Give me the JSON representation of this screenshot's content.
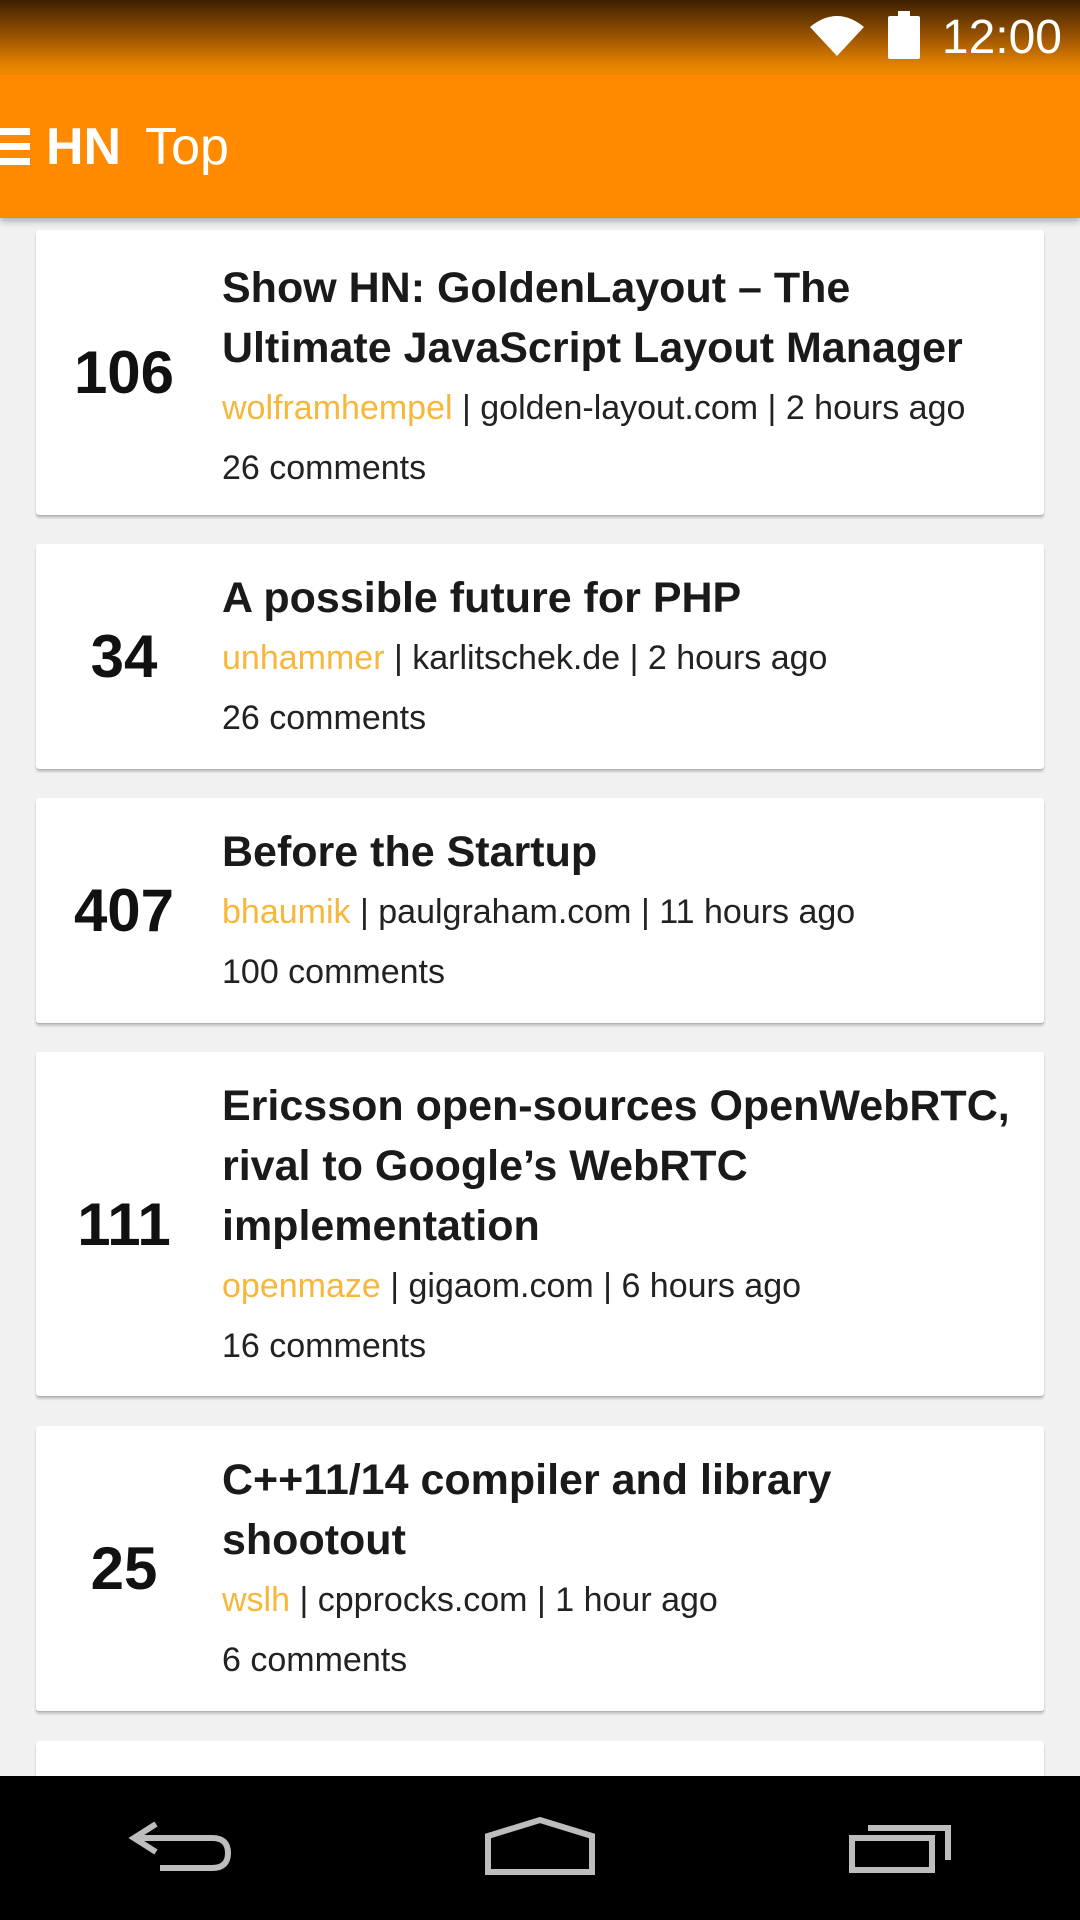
{
  "status_bar": {
    "time": "12:00",
    "icons": [
      "wifi-icon",
      "battery-icon"
    ]
  },
  "toolbar": {
    "logo": "HN",
    "title": "Top",
    "menu_icon": "menu-icon"
  },
  "colors": {
    "accent": "#ff8a00",
    "author": "#f7b73a",
    "background": "#f1f1f1"
  },
  "stories": [
    {
      "score": "106",
      "title": "Show HN: GoldenLayout – The Ultimate JavaScript Layout Manager",
      "author": "wolframhempel",
      "domain": "golden-layout.com",
      "time": "2 hours ago",
      "comments": "26 comments"
    },
    {
      "score": "34",
      "title": "A possible future for PHP",
      "author": "unhammer",
      "domain": "karlitschek.de",
      "time": "2 hours ago",
      "comments": "26 comments"
    },
    {
      "score": "407",
      "title": "Before the Startup",
      "author": "bhaumik",
      "domain": "paulgraham.com",
      "time": "11 hours ago",
      "comments": "100 comments"
    },
    {
      "score": "111",
      "title": "Ericsson open-sources OpenWebRTC, rival to Google’s WebRTC implementation",
      "author": "openmaze",
      "domain": "gigaom.com",
      "time": "6 hours ago",
      "comments": "16 comments"
    },
    {
      "score": "25",
      "title": "C++11/14 compiler and library shootout",
      "author": "wslh",
      "domain": "cpprocks.com",
      "time": "1 hour ago",
      "comments": "6 comments"
    }
  ],
  "nav_bar": {
    "icons": [
      "back-icon",
      "home-icon",
      "recents-icon"
    ]
  }
}
